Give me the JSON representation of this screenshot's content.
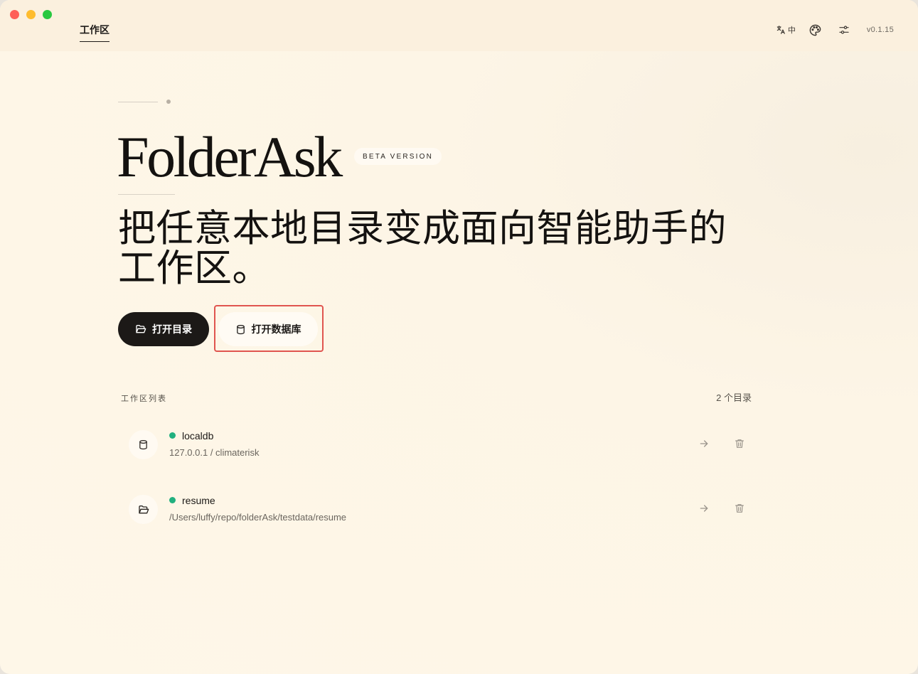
{
  "titlebar": {
    "tab_label": "工作区",
    "lang_label": "中",
    "version": "v0.1.15"
  },
  "hero": {
    "brand": "FolderAsk",
    "badge": "BETA VERSION",
    "headline": "把任意本地目录变成面向智能助手的工作区。"
  },
  "actions": {
    "open_folder_label": "打开目录",
    "open_database_label": "打开数据库"
  },
  "workspace_list": {
    "title": "工作区列表",
    "count": "2 个目录",
    "items": [
      {
        "name": "localdb",
        "path": "127.0.0.1 / climaterisk",
        "type_icon": "database-icon",
        "status_color": "#21b07f"
      },
      {
        "name": "resume",
        "path": "/Users/luffy/repo/folderAsk/testdata/resume",
        "type_icon": "folder-open-icon",
        "status_color": "#21b07f"
      }
    ]
  },
  "colors": {
    "accent_dark": "#1c1917",
    "status_green": "#21b07f",
    "highlight_red": "#e0554f",
    "background": "#fef7e8"
  }
}
